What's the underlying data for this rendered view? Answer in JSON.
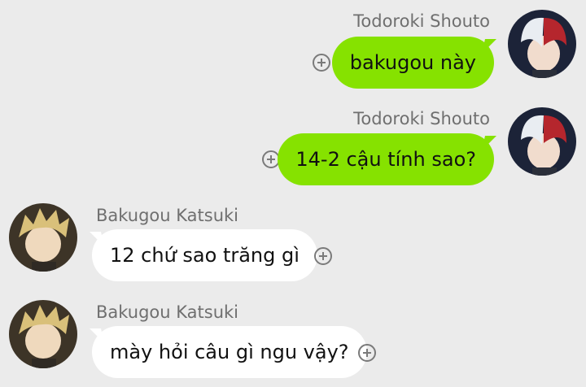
{
  "messages": [
    {
      "sender": "Todoroki Shouto",
      "text": "bakugou này",
      "direction": "outgoing"
    },
    {
      "sender": "Todoroki Shouto",
      "text": "14-2 cậu tính sao?",
      "direction": "outgoing"
    },
    {
      "sender": "Bakugou Katsuki",
      "text": "12 chứ sao trăng gì",
      "direction": "incoming"
    },
    {
      "sender": "Bakugou Katsuki",
      "text": "mày hỏi câu gì ngu vậy?",
      "direction": "incoming"
    }
  ],
  "colors": {
    "background": "#ebebeb",
    "outgoing_bubble": "#86e200",
    "incoming_bubble": "#ffffff",
    "sender_name": "#6f6f6f"
  },
  "icons": {
    "add_reaction": "plus-circle-icon"
  }
}
